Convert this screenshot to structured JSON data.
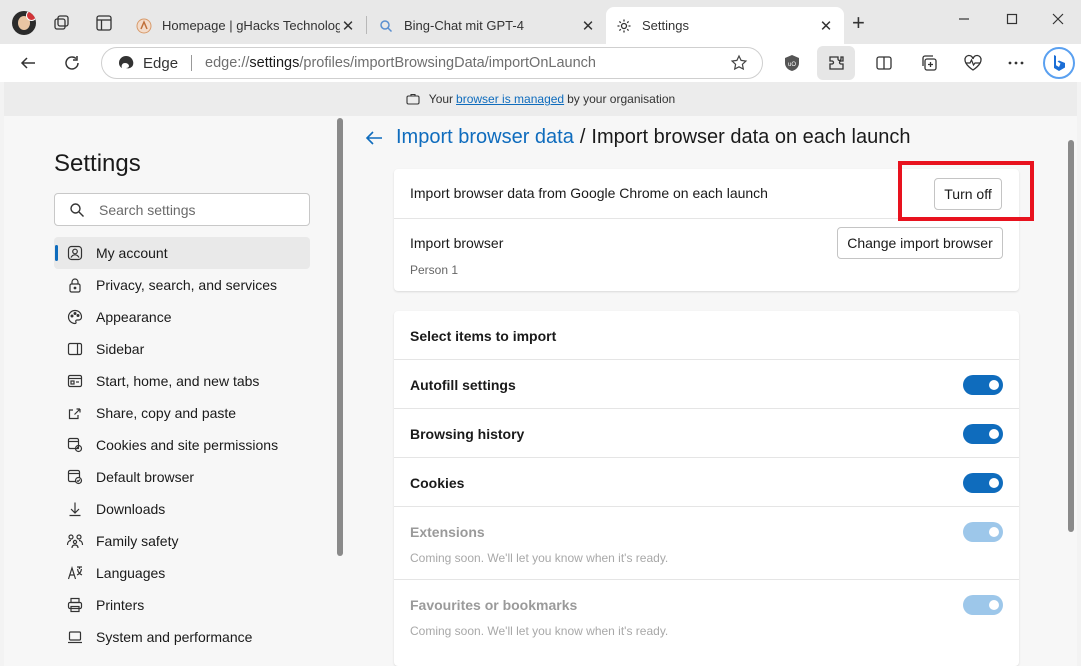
{
  "tabs": [
    {
      "title": "Homepage | gHacks Technology News",
      "icon": "ghacks-icon",
      "close": "✕"
    },
    {
      "title": "Bing-Chat mit GPT-4",
      "icon": "search-icon",
      "close": "✕"
    },
    {
      "title": "Settings",
      "icon": "gear-icon",
      "close": "✕"
    }
  ],
  "new_tab": "+",
  "address": {
    "brand": "Edge",
    "url_prefix": "edge://",
    "url_host": "settings",
    "url_path": "/profiles/importBrowsingData/importOnLaunch"
  },
  "managed": {
    "before": "Your",
    "link": "browser is managed",
    "after": "by your organisation"
  },
  "sidebar": {
    "title": "Settings",
    "search_placeholder": "Search settings",
    "items": [
      {
        "label": "My account",
        "icon": "account-icon",
        "selected": true
      },
      {
        "label": "Privacy, search, and services",
        "icon": "lock-icon"
      },
      {
        "label": "Appearance",
        "icon": "palette-icon"
      },
      {
        "label": "Sidebar",
        "icon": "sidebar-icon"
      },
      {
        "label": "Start, home, and new tabs",
        "icon": "home-tabs-icon"
      },
      {
        "label": "Share, copy and paste",
        "icon": "share-icon"
      },
      {
        "label": "Cookies and site permissions",
        "icon": "cookies-icon"
      },
      {
        "label": "Default browser",
        "icon": "browser-icon"
      },
      {
        "label": "Downloads",
        "icon": "download-icon"
      },
      {
        "label": "Family safety",
        "icon": "family-icon"
      },
      {
        "label": "Languages",
        "icon": "languages-icon"
      },
      {
        "label": "Printers",
        "icon": "printer-icon"
      },
      {
        "label": "System and performance",
        "icon": "laptop-icon"
      }
    ]
  },
  "main": {
    "breadcrumb_link": "Import browser data",
    "breadcrumb_sep": "/",
    "breadcrumb_current": "Import browser data on each launch",
    "import_on_launch": {
      "label": "Import browser data from Google Chrome on each launch",
      "button": "Turn off"
    },
    "import_browser": {
      "label": "Import browser",
      "value": "Person 1",
      "button": "Change import browser"
    },
    "select_title": "Select items to import",
    "items": [
      {
        "label": "Autofill settings",
        "on": true,
        "disabled": false
      },
      {
        "label": "Browsing history",
        "on": true,
        "disabled": false
      },
      {
        "label": "Cookies",
        "on": true,
        "disabled": false
      },
      {
        "label": "Extensions",
        "on": true,
        "disabled": true,
        "sub": "Coming soon. We'll let you know when it's ready."
      },
      {
        "label": "Favourites or bookmarks",
        "on": true,
        "disabled": true,
        "sub": "Coming soon. We'll let you know when it's ready."
      }
    ]
  },
  "colors": {
    "accent": "#0f6cbd",
    "highlight": "#e8121e",
    "toggle_disabled": "#9dc7ea"
  }
}
